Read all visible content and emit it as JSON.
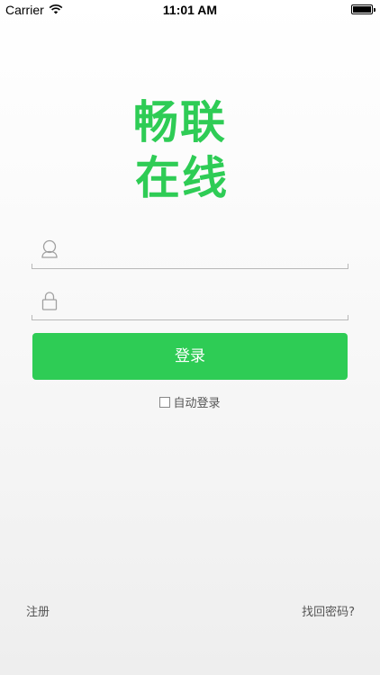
{
  "status_bar": {
    "carrier": "Carrier",
    "time": "11:01 AM"
  },
  "logo": {
    "line1": "畅联",
    "line2": "在线"
  },
  "form": {
    "username_placeholder": "",
    "password_placeholder": "",
    "login_label": "登录",
    "auto_login_label": "自动登录"
  },
  "footer": {
    "register_label": "注册",
    "forgot_label": "找回密码?"
  },
  "colors": {
    "accent": "#2ecc55"
  },
  "icons": {
    "username": "user-icon",
    "password": "lock-icon",
    "wifi": "wifi-icon",
    "battery": "battery-icon"
  }
}
